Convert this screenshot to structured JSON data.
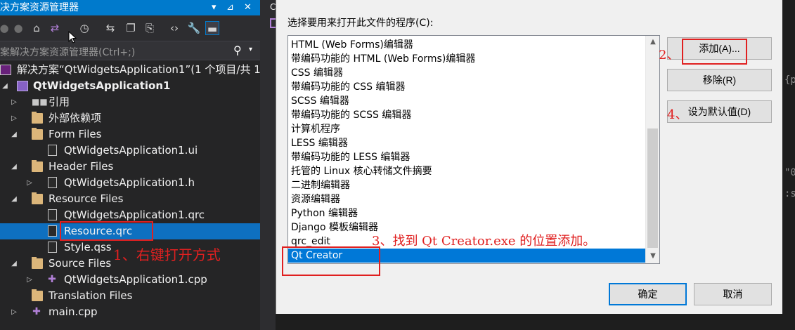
{
  "solution_explorer": {
    "title": "决方案资源管理器",
    "pin_glyph": "▾",
    "pin2_glyph": "⊿",
    "close_glyph": "✕",
    "search_placeholder": "案解决方案资源管理器(Ctrl+;)",
    "tree": {
      "solution": "解决方案“QtWidgetsApplication1”(1 个项目/共 1",
      "project": "QtWidgetsApplication1",
      "references": "引用",
      "external_deps": "外部依赖项",
      "form_files": "Form Files",
      "ui_file": "QtWidgetsApplication1.ui",
      "header_files": "Header Files",
      "h_file": "QtWidgetsApplication1.h",
      "resource_files": "Resource Files",
      "qrc_file": "QtWidgetsApplication1.qrc",
      "resource_qrc": "Resource.qrc",
      "style_qss": "Style.qss",
      "source_files": "Source Files",
      "cpp_file": "QtWidgetsApplication1.cpp",
      "translation_files": "Translation Files",
      "main_cpp": "main.cpp"
    }
  },
  "editor_tab_letter": "C",
  "right_code_fragments": [
    "{pa",
    "\"0",
    ":s"
  ],
  "dialog": {
    "prompt": "选择要用来打开此文件的程序(C):",
    "programs": [
      "HTML (Web Forms)编辑器",
      "带编码功能的 HTML (Web Forms)编辑器",
      "CSS 编辑器",
      "带编码功能的 CSS 编辑器",
      "SCSS 编辑器",
      "带编码功能的 SCSS 编辑器",
      "计算机程序",
      "LESS 编辑器",
      "带编码功能的 LESS 编辑器",
      "托管的 Linux 核心转储文件摘要",
      "二进制编辑器",
      "资源编辑器",
      "Python 编辑器",
      "Django 模板编辑器",
      "qrc_edit",
      "Qt Creator"
    ],
    "selected_program": "Qt Creator",
    "buttons": {
      "add": "添加(A)...",
      "remove": "移除(R)",
      "set_default": "设为默认值(D)",
      "ok": "确定",
      "cancel": "取消"
    }
  },
  "annotations": {
    "step1": "1、右键打开方式",
    "step2": "2、",
    "step3": "3、找到 Qt Creator.exe 的位置添加。",
    "step4": "4、",
    "color": "#e02020"
  }
}
